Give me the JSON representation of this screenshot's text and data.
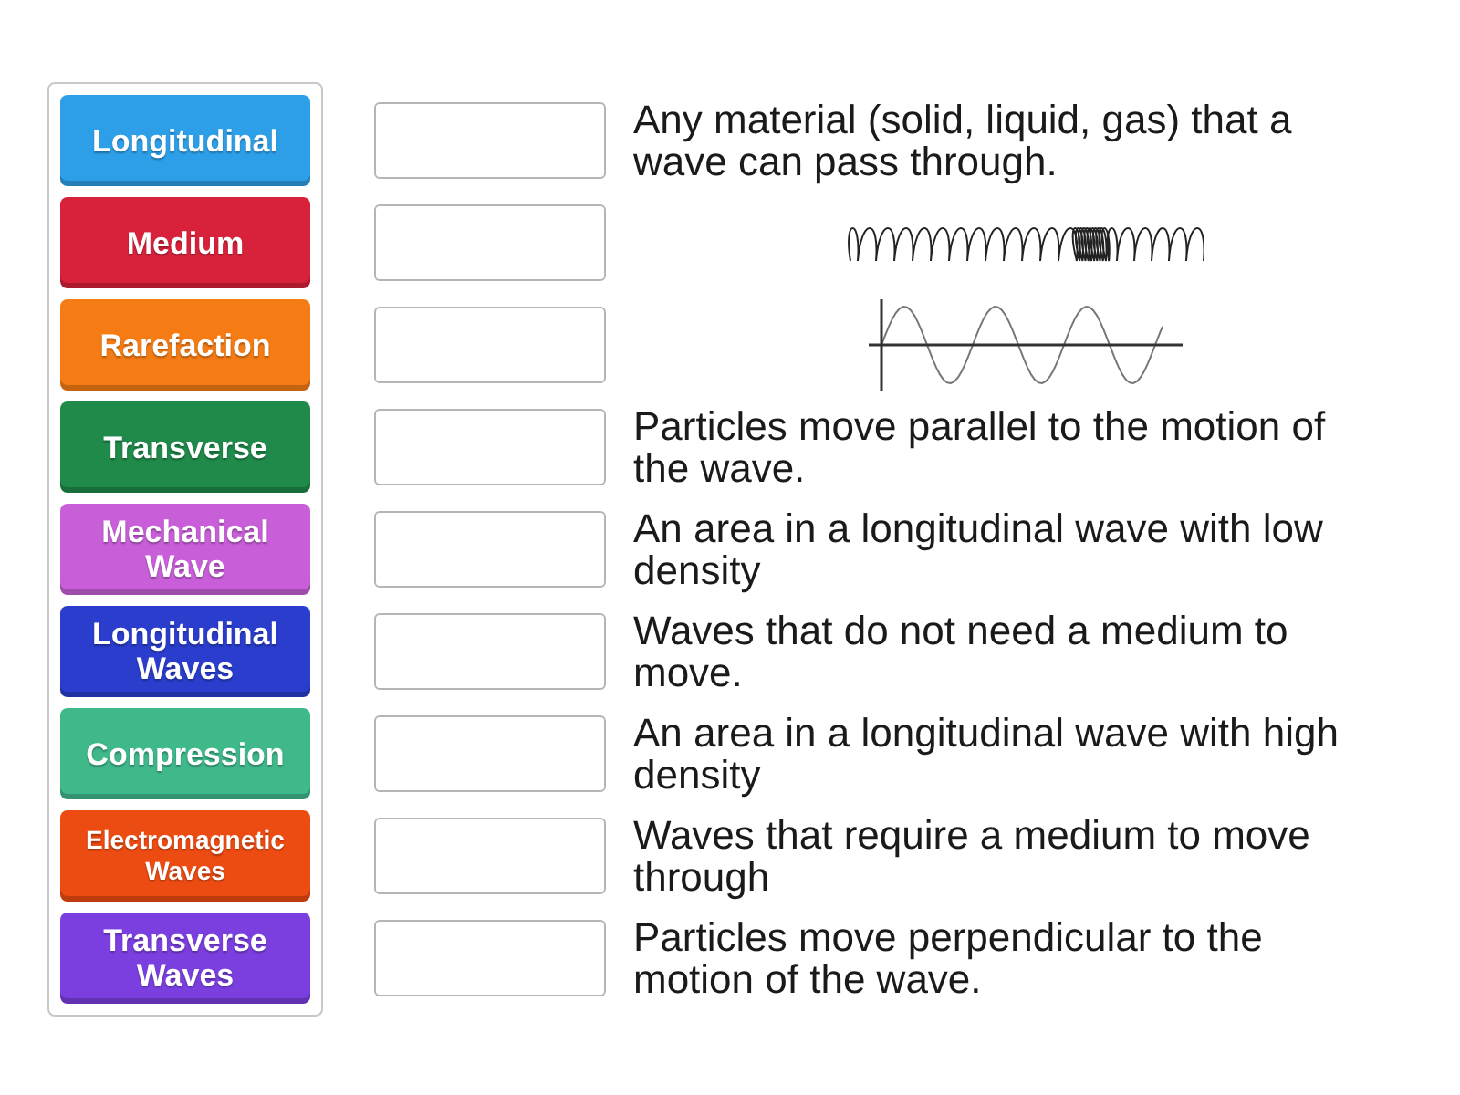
{
  "tiles": [
    {
      "label": "Longitudinal",
      "color": "#2d9fe8"
    },
    {
      "label": "Medium",
      "color": "#d8213a"
    },
    {
      "label": "Rarefaction",
      "color": "#f57c14"
    },
    {
      "label": "Transverse",
      "color": "#1f8a4a"
    },
    {
      "label": "Mechanical Wave",
      "color": "#c85fd8"
    },
    {
      "label": "Longitudinal Waves",
      "color": "#2a3dcc"
    },
    {
      "label": "Compression",
      "color": "#3fb88a"
    },
    {
      "label": "Electromagnetic Waves",
      "color": "#ec4b12"
    },
    {
      "label": "Transverse Waves",
      "color": "#7b3fe0"
    }
  ],
  "rows": [
    {
      "kind": "text",
      "text": "Any material (solid, liquid, gas) that a wave can pass through."
    },
    {
      "kind": "spring"
    },
    {
      "kind": "wave"
    },
    {
      "kind": "text",
      "text": "Particles move parallel to the motion of the wave."
    },
    {
      "kind": "text",
      "text": "An area in a longitudinal wave with low density"
    },
    {
      "kind": "text",
      "text": "Waves that do not need a medium to move."
    },
    {
      "kind": "text",
      "text": "An area in a longitudinal wave with high density"
    },
    {
      "kind": "text",
      "text": "Waves that require a medium to move through"
    },
    {
      "kind": "text",
      "text": "Particles move perpendicular to the motion of the wave."
    }
  ]
}
